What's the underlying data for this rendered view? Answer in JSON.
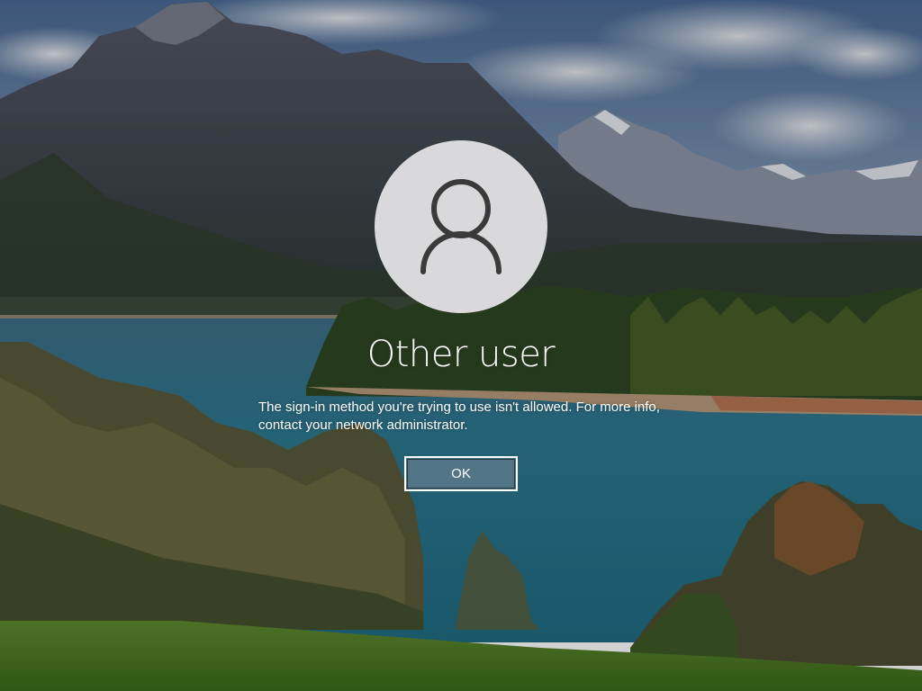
{
  "lock_screen": {
    "user_name": "Other user",
    "message": "The sign-in method you're trying to use isn't allowed. For more info, contact your network administrator.",
    "ok_label": "OK",
    "avatar_icon": "user-silhouette-icon",
    "background": "mountain-lake-landscape"
  }
}
